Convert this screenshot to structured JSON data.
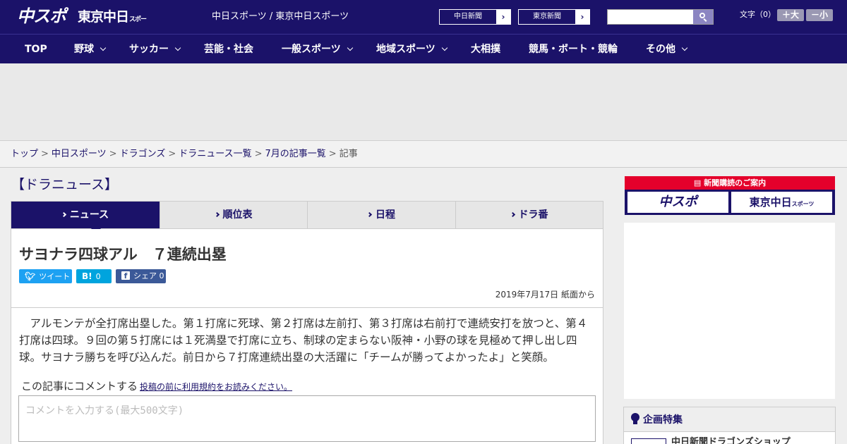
{
  "header": {
    "logo_chuspo": "中スポ",
    "logo_tokyo": "東京中日",
    "logo_tokyo_sub": "スポーツ",
    "site_links": "中日スポーツ / 東京中日スポーツ",
    "paper_links": [
      "中日新聞",
      "東京新聞"
    ],
    "search": {
      "placeholder": ""
    },
    "font_size_label": "文字（0）",
    "font_larger": "＋大",
    "font_smaller": "－小"
  },
  "nav": [
    {
      "label": "TOP",
      "dropdown": false
    },
    {
      "label": "野球",
      "dropdown": true
    },
    {
      "label": "サッカー",
      "dropdown": true
    },
    {
      "label": "芸能・社会",
      "dropdown": false
    },
    {
      "label": "一般スポーツ",
      "dropdown": true
    },
    {
      "label": "地域スポーツ",
      "dropdown": true
    },
    {
      "label": "大相撲",
      "dropdown": false
    },
    {
      "label": "競馬・ボート・競輪",
      "dropdown": false
    },
    {
      "label": "その他",
      "dropdown": true
    }
  ],
  "breadcrumb": {
    "links": [
      "トップ",
      "中日スポーツ",
      "ドラゴンズ",
      "ドラニュース一覧",
      "7月の記事一覧"
    ],
    "current": "記事"
  },
  "section_title": "【ドラニュース】",
  "tabs": [
    {
      "label": "ニュース",
      "active": true
    },
    {
      "label": "順位表",
      "active": false
    },
    {
      "label": "日程",
      "active": false
    },
    {
      "label": "ドラ番",
      "active": false
    }
  ],
  "article": {
    "title": "サヨナラ四球アル　７連続出塁",
    "share": {
      "tweet": "ツイート",
      "hatena_icon": "B!",
      "hatena_count": "0",
      "facebook": "シェア 0"
    },
    "date": "2019年7月17日 紙面から",
    "body": "アルモンテが全打席出塁した。第１打席に死球、第２打席は左前打、第３打席は右前打で連続安打を放つと、第４打席は四球。９回の第５打席には１死満塁で打席に立ち、制球の定まらない阪神・小野の球を見極めて押し出し四球。サヨナラ勝ちを呼び込んだ。前日から７打席連続出塁の大活躍に「チームが勝ってよかったよ」と笑顔。",
    "comment_label": "この記事にコメントする",
    "comment_terms": "投稿の前に利用規約をお読みください。",
    "comment_placeholder": "コメントを入力する(最大500文字)"
  },
  "sidebar": {
    "subscribe_head": "新聞購読のご案内",
    "subscribe_chuspo": "中スポ",
    "subscribe_tokyo": "東京中日",
    "subscribe_tokyo_sub": "スポーツ",
    "feature_title": "企画特集",
    "feature_item": "中日新聞ドラゴンズショップ"
  },
  "colors": {
    "brand_navy": "#1b1269",
    "accent_red": "#e4002b",
    "twitter": "#1da1f2",
    "hatena": "#00a4de",
    "facebook": "#3b5998"
  }
}
